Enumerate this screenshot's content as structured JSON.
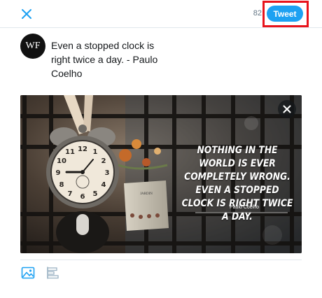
{
  "header": {
    "close_icon": "close-icon",
    "char_count": "82",
    "tweet_label": "Tweet",
    "accent": "#1da1f2",
    "highlight_color": "#e8141c"
  },
  "avatar": {
    "initials": "WF"
  },
  "composer": {
    "text": "Even a stopped clock is\nright twice a day. -  Paulo\nCoelho"
  },
  "media": {
    "quote": "Nothing in the world is ever completely wrong. Even a stopped clock is right twice a day.",
    "author": "Paulo Coelho",
    "jar_label": "JARDIN",
    "remove_icon": "close-icon"
  },
  "toolbar": {
    "image_icon": "image-icon",
    "poll_icon": "poll-icon"
  }
}
